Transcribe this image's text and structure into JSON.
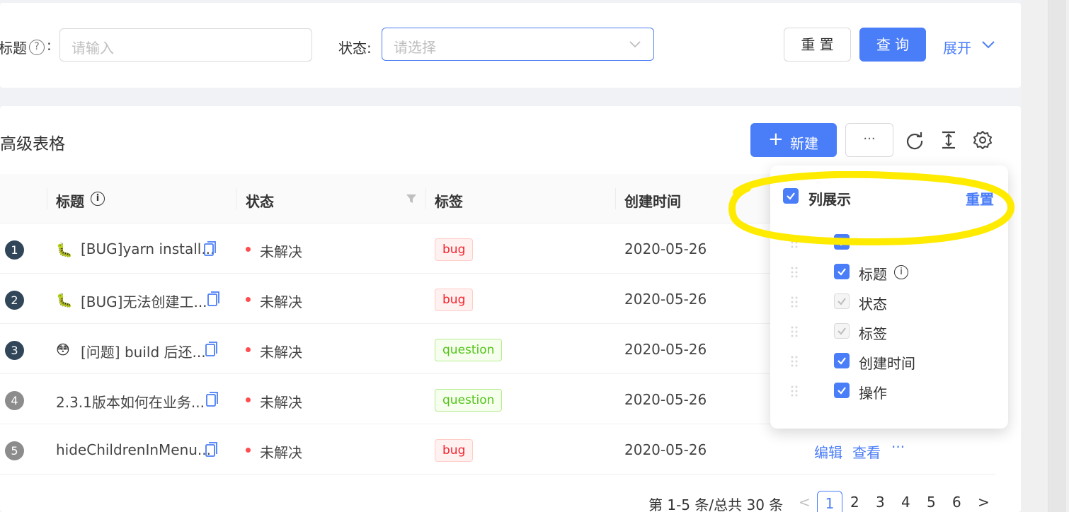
{
  "search": {
    "title_label": "标题",
    "title_colon": ":",
    "title_placeholder": "请输入",
    "status_label": "状态:",
    "status_placeholder": "请选择",
    "reset_label": "重 置",
    "query_label": "查 询",
    "expand_label": "展开"
  },
  "table": {
    "card_title": "高级表格",
    "new_label": "新建",
    "more_label": "···",
    "columns": {
      "title": "标题",
      "status": "状态",
      "tag": "标签",
      "created": "创建时间"
    },
    "rows": [
      {
        "index": "1",
        "emoji": "🐛",
        "title": "[BUG]yarn install...",
        "status": "未解决",
        "tag": "bug",
        "date": "2020-05-26"
      },
      {
        "index": "2",
        "emoji": "🐛",
        "title": "[BUG]无法创建工...",
        "status": "未解决",
        "tag": "bug",
        "date": "2020-05-26"
      },
      {
        "index": "3",
        "emoji": "😳",
        "title": "[问题] build 后还...",
        "status": "未解决",
        "tag": "question",
        "date": "2020-05-26"
      },
      {
        "index": "4",
        "emoji": "",
        "title": "2.3.1版本如何在业务...",
        "status": "未解决",
        "tag": "question",
        "date": "2020-05-26"
      },
      {
        "index": "5",
        "emoji": "",
        "title": "hideChildrenInMenu...",
        "status": "未解决",
        "tag": "bug",
        "date": "2020-05-26"
      }
    ],
    "row5_actions": {
      "edit": "编辑",
      "view": "查看",
      "more": "···"
    }
  },
  "pagination": {
    "summary": "第 1-5 条/总共 30 条",
    "prev": "<",
    "next": ">",
    "current": "1",
    "pages": [
      "2",
      "3",
      "4",
      "5",
      "6"
    ]
  },
  "column_settings": {
    "title": "列展示",
    "reset": "重置",
    "items": [
      {
        "label": "",
        "state": "checked"
      },
      {
        "label": "标题",
        "state": "checked"
      },
      {
        "label": "状态",
        "state": "disabled"
      },
      {
        "label": "标签",
        "state": "disabled"
      },
      {
        "label": "创建时间",
        "state": "checked"
      },
      {
        "label": "操作",
        "state": "checked"
      }
    ]
  },
  "colors": {
    "primary": "#4a7df8",
    "danger": "#ff4d4f",
    "highlight": "#ffeb00"
  }
}
